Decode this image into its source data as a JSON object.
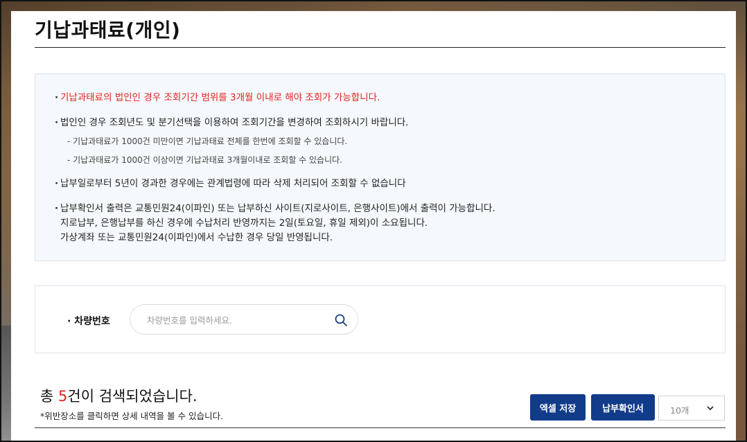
{
  "page": {
    "title": "기납과태료(개인)"
  },
  "notices": {
    "item1": "기납과태료의 법인인 경우 조회기간 범위를 3개월 이내로 해야 조회가 가능합니다.",
    "item2": "법인인 경우 조회년도 및 분기선택을 이용하여 조회기간을 변경하여 조회하시기 바랍니다.",
    "item2_sub1": "- 기납과태료가 1000건 미만이면 기납과태료 전체를 한번에 조회할 수 있습니다.",
    "item2_sub2": "- 기납과태료가 1000건 이상이면 기납과태료 3개월이내로 조회할 수 있습니다.",
    "item3": "납부일로부터 5년이 경과한 경우에는 관계법령에 따라 삭제 처리되어 조회할 수 없습니다",
    "item4_line1": "납부확인서 출력은 교통민원24(이파인) 또는 납부하신 사이트(지로사이트, 은행사이트)에서 출력이 가능합니다.",
    "item4_line2": "지로납부, 은행납부를 하신 경우에 수납처리 반영까지는 2일(토요일, 휴일 제외)이 소요됩니다.",
    "item4_line3": "가상계좌 또는 교통민원24(이파인)에서 수납한 경우 당일 반영됩니다."
  },
  "search": {
    "label": "· 차량번호",
    "placeholder": "차량번호를 입력하세요.",
    "value": ""
  },
  "results": {
    "prefix": "총 ",
    "count": "5",
    "suffix": "건이 검색되었습니다.",
    "note": "*위반장소를 클릭하면 상세 내역을 볼 수 있습니다."
  },
  "toolbar": {
    "excel_label": "엑셀 저장",
    "receipt_label": "납부확인서",
    "page_size_value": "10개"
  },
  "colors": {
    "accent": "#123c8a",
    "alert": "#e0231c"
  },
  "icons": {
    "search": "search-icon",
    "dropdown": "chevron-down-icon"
  }
}
